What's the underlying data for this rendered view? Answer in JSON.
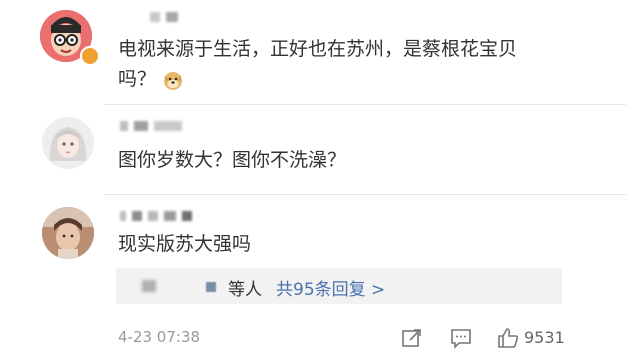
{
  "comments": [
    {
      "text_line1": "电视来源于生活，正好也在苏州，是蔡根花宝贝",
      "text_line2": "吗？",
      "emoji": "doge-emoji"
    },
    {
      "text_line1": "图你岁数大？图你不洗澡？"
    },
    {
      "text_line1": "现实版苏大强吗"
    }
  ],
  "replies": {
    "wait_text": "等人",
    "link_text": "共95条回复 >"
  },
  "footer": {
    "time": "4-23 07:38",
    "likes": "9531",
    "icons": [
      "share-icon",
      "comment-icon",
      "like-icon"
    ]
  },
  "colors": {
    "link": "#4a72b0",
    "text": "#333333",
    "meta": "#999999",
    "reply_bg": "#f2f2f2"
  }
}
